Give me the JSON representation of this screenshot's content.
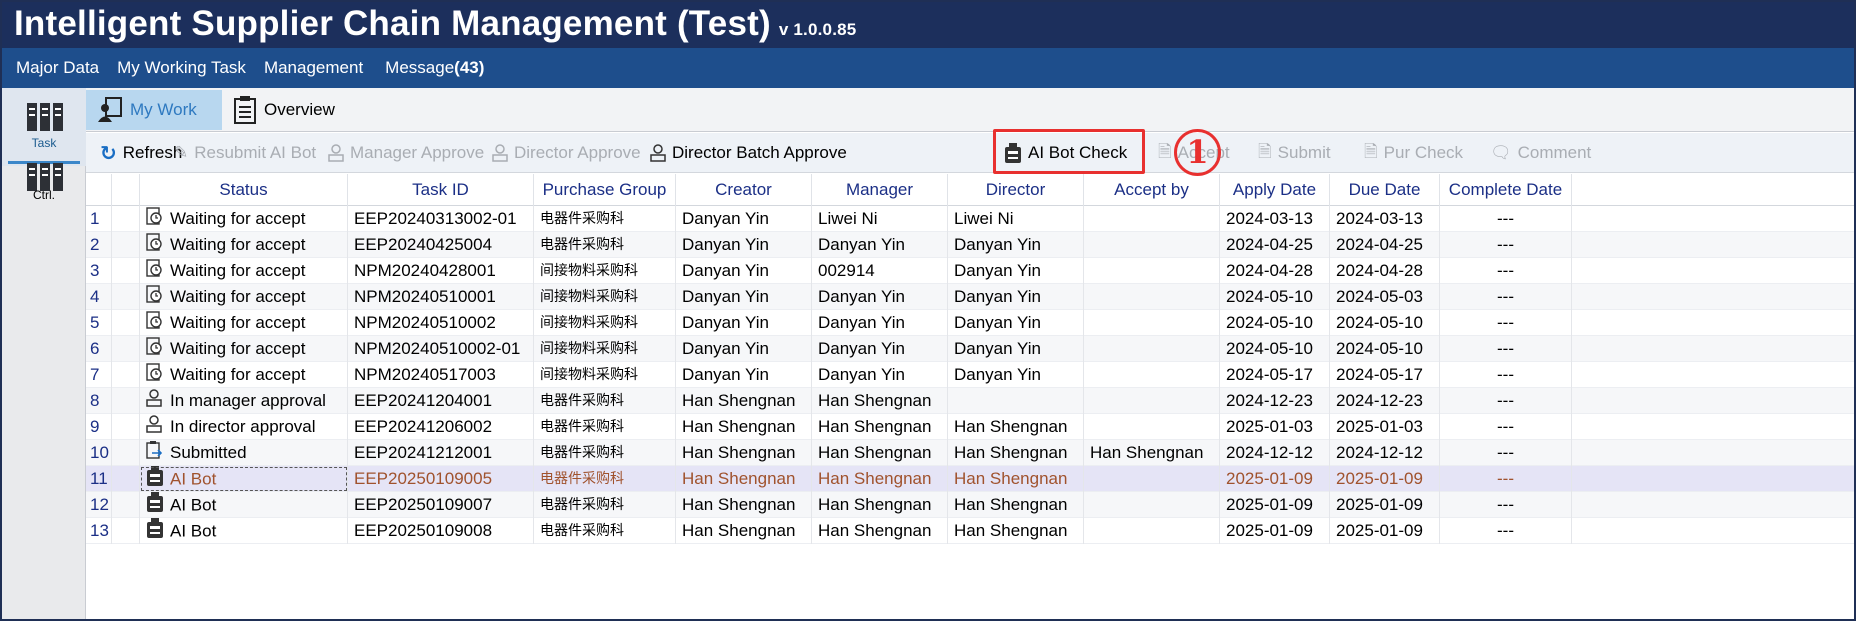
{
  "app": {
    "title": "Intelligent Supplier Chain Management (Test)",
    "version": "v 1.0.0.85"
  },
  "menu": {
    "items": [
      "Major Data",
      "My Working Task",
      "Management"
    ],
    "message_label": "Message",
    "message_count": "(43)"
  },
  "left_rail": {
    "task_label": "Task",
    "ctrl_label": "Ctrl."
  },
  "tabs": [
    {
      "label": "My Work",
      "active": true
    },
    {
      "label": "Overview",
      "active": false
    }
  ],
  "toolbar": {
    "refresh": "Refresh",
    "resubmit_ai_bot": "Resubmit AI Bot",
    "manager_approve": "Manager Approve",
    "director_approve": "Director Approve",
    "director_batch_approve": "Director Batch Approve",
    "ai_bot_check": "AI Bot Check",
    "accept": "Accept",
    "submit": "Submit",
    "pur_check": "Pur Check",
    "comment": "Comment"
  },
  "annotation": {
    "step_number": "1",
    "highlight_color": "#e8302f"
  },
  "grid": {
    "columns": [
      "Status",
      "Task ID",
      "Purchase Group",
      "Creator",
      "Manager",
      "Director",
      "Accept by",
      "Apply Date",
      "Due Date",
      "Complete Date"
    ],
    "rows": [
      {
        "n": "1",
        "status": "Waiting for accept",
        "icon": "clock-doc-icon",
        "task_id": "EEP20240313002-01",
        "group": "电器件采购科",
        "creator": "Danyan Yin",
        "manager": "Liwei Ni",
        "director": "Liwei Ni",
        "accept_by": "",
        "apply": "2024-03-13",
        "due": "2024-03-13",
        "complete": "---"
      },
      {
        "n": "2",
        "status": "Waiting for accept",
        "icon": "clock-doc-icon",
        "task_id": "EEP20240425004",
        "group": "电器件采购科",
        "creator": "Danyan Yin",
        "manager": "Danyan Yin",
        "director": "Danyan Yin",
        "accept_by": "",
        "apply": "2024-04-25",
        "due": "2024-04-25",
        "complete": "---"
      },
      {
        "n": "3",
        "status": "Waiting for accept",
        "icon": "clock-doc-icon",
        "task_id": "NPM20240428001",
        "group": "间接物料采购科",
        "creator": "Danyan Yin",
        "manager": "002914",
        "director": "Danyan Yin",
        "accept_by": "",
        "apply": "2024-04-28",
        "due": "2024-04-28",
        "complete": "---"
      },
      {
        "n": "4",
        "status": "Waiting for accept",
        "icon": "clock-doc-icon",
        "task_id": "NPM20240510001",
        "group": "间接物料采购科",
        "creator": "Danyan Yin",
        "manager": "Danyan Yin",
        "director": "Danyan Yin",
        "accept_by": "",
        "apply": "2024-05-10",
        "due": "2024-05-03",
        "complete": "---"
      },
      {
        "n": "5",
        "status": "Waiting for accept",
        "icon": "clock-doc-icon",
        "task_id": "NPM20240510002",
        "group": "间接物料采购科",
        "creator": "Danyan Yin",
        "manager": "Danyan Yin",
        "director": "Danyan Yin",
        "accept_by": "",
        "apply": "2024-05-10",
        "due": "2024-05-10",
        "complete": "---"
      },
      {
        "n": "6",
        "status": "Waiting for accept",
        "icon": "clock-doc-icon",
        "task_id": "NPM20240510002-01",
        "group": "间接物料采购科",
        "creator": "Danyan Yin",
        "manager": "Danyan Yin",
        "director": "Danyan Yin",
        "accept_by": "",
        "apply": "2024-05-10",
        "due": "2024-05-10",
        "complete": "---"
      },
      {
        "n": "7",
        "status": "Waiting for accept",
        "icon": "clock-doc-icon",
        "task_id": "NPM20240517003",
        "group": "间接物料采购科",
        "creator": "Danyan Yin",
        "manager": "Danyan Yin",
        "director": "Danyan Yin",
        "accept_by": "",
        "apply": "2024-05-17",
        "due": "2024-05-17",
        "complete": "---"
      },
      {
        "n": "8",
        "status": "In manager approval",
        "icon": "person-icon",
        "task_id": "EEP20241204001",
        "group": "电器件采购科",
        "creator": "Han Shengnan",
        "manager": "Han Shengnan",
        "director": "",
        "accept_by": "",
        "apply": "2024-12-23",
        "due": "2024-12-23",
        "complete": "---"
      },
      {
        "n": "9",
        "status": "In director approval",
        "icon": "person-icon",
        "task_id": "EEP20241206002",
        "group": "电器件采购科",
        "creator": "Han Shengnan",
        "manager": "Han Shengnan",
        "director": "Han Shengnan",
        "accept_by": "",
        "apply": "2025-01-03",
        "due": "2025-01-03",
        "complete": "---"
      },
      {
        "n": "10",
        "status": "Submitted",
        "icon": "submit-doc-icon",
        "task_id": "EEP20241212001",
        "group": "电器件采购科",
        "creator": "Han Shengnan",
        "manager": "Han Shengnan",
        "director": "Han Shengnan",
        "accept_by": "Han Shengnan",
        "apply": "2024-12-12",
        "due": "2024-12-12",
        "complete": "---"
      },
      {
        "n": "11",
        "status": "AI Bot",
        "icon": "robot-icon",
        "task_id": "EEP20250109005",
        "group": "电器件采购科",
        "creator": "Han Shengnan",
        "manager": "Han Shengnan",
        "director": "Han Shengnan",
        "accept_by": "",
        "apply": "2025-01-09",
        "due": "2025-01-09",
        "complete": "---",
        "selected": true
      },
      {
        "n": "12",
        "status": "AI Bot",
        "icon": "robot-icon",
        "task_id": "EEP20250109007",
        "group": "电器件采购科",
        "creator": "Han Shengnan",
        "manager": "Han Shengnan",
        "director": "Han Shengnan",
        "accept_by": "",
        "apply": "2025-01-09",
        "due": "2025-01-09",
        "complete": "---"
      },
      {
        "n": "13",
        "status": "AI Bot",
        "icon": "robot-icon",
        "task_id": "EEP20250109008",
        "group": "电器件采购科",
        "creator": "Han Shengnan",
        "manager": "Han Shengnan",
        "director": "Han Shengnan",
        "accept_by": "",
        "apply": "2025-01-09",
        "due": "2025-01-09",
        "complete": "---"
      }
    ]
  },
  "colors": {
    "title_bar": "#1c2f5c",
    "menu_bar": "#1e4e8c",
    "header_text": "#1b2f86",
    "selected_row_bg": "#e5e4f6",
    "selected_row_text": "#a0522d"
  }
}
